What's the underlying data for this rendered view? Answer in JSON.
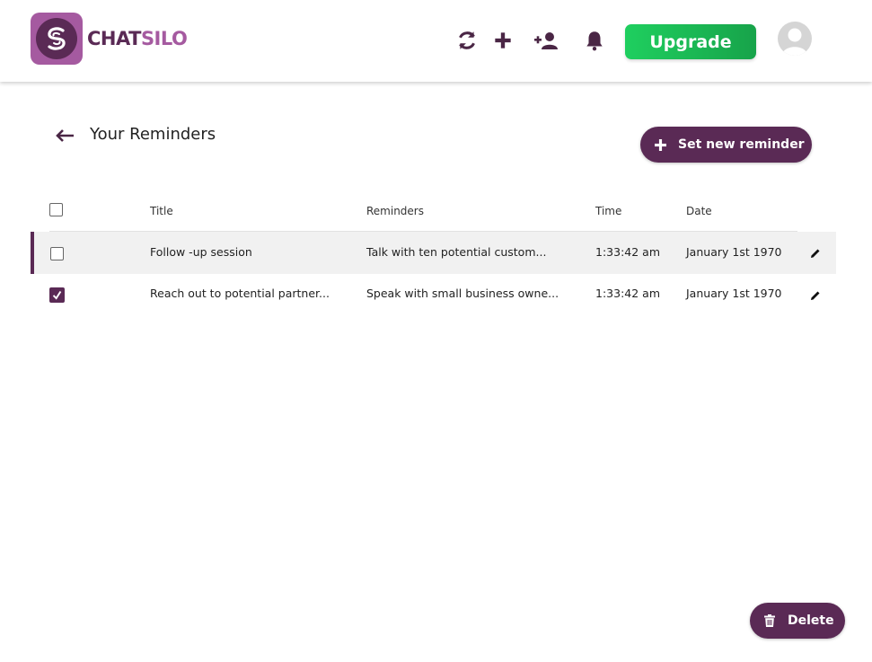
{
  "brand": {
    "name_part1": "CHAT",
    "name_part2": "SILO"
  },
  "header": {
    "icons": [
      "refresh-icon",
      "plus-icon",
      "add-user-icon",
      "bell-icon"
    ],
    "upgrade_label": "Upgrade"
  },
  "page": {
    "title": "Your Reminders",
    "new_button_label": "Set new reminder",
    "delete_button_label": "Delete"
  },
  "table": {
    "columns": [
      "Title",
      "Reminders",
      "Time",
      "Date"
    ],
    "rows": [
      {
        "title": "Follow -up session",
        "reminder": "Talk with ten potential custom...",
        "time": "1:33:42 am",
        "date": "January 1st 1970",
        "checked": false,
        "highlighted": true
      },
      {
        "title": "Reach out to potential partner...",
        "reminder": "Speak with small business owne...",
        "time": "1:33:42 am",
        "date": "January 1st 1970",
        "checked": true,
        "highlighted": false
      }
    ]
  },
  "colors": {
    "brand_dark": "#5a2a55",
    "brand_light": "#a55aa0",
    "upgrade_green": "#1fcf5f"
  }
}
